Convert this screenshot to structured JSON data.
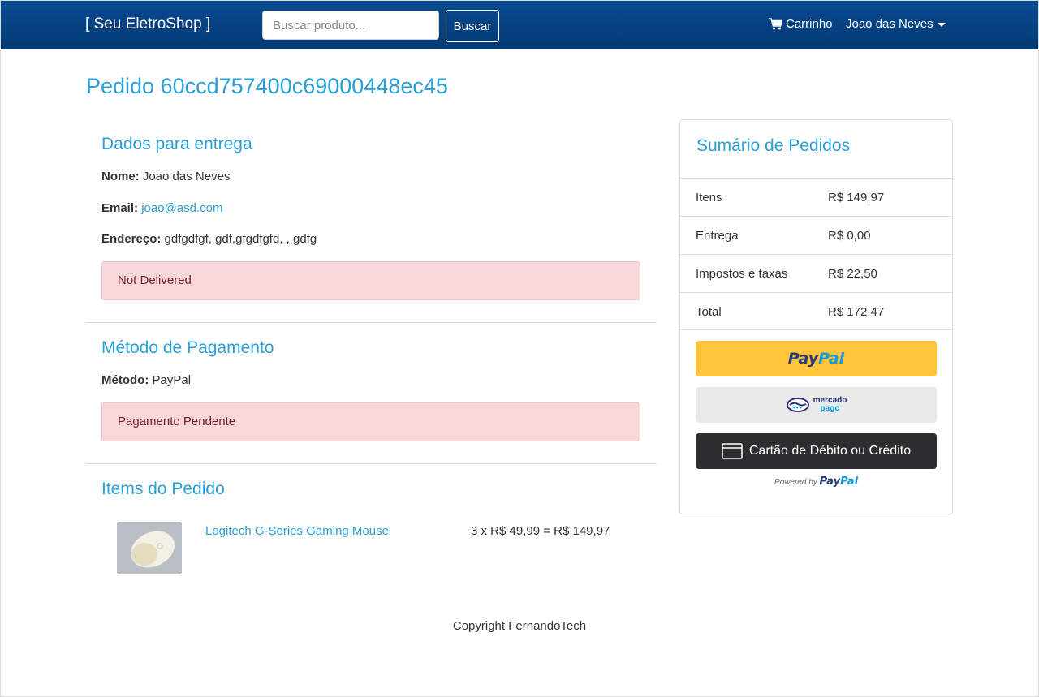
{
  "navbar": {
    "brand": "[ Seu EletroShop ]",
    "search_placeholder": "Buscar produto...",
    "search_button": "Buscar",
    "cart_label": "Carrinho",
    "user_label": "Joao das Neves"
  },
  "order": {
    "title": "Pedido 60ccd757400c69000448ec45"
  },
  "delivery": {
    "heading": "Dados para entrega",
    "name_label": "Nome:",
    "name_value": "Joao das Neves",
    "email_label": "Email:",
    "email_value": "joao@asd.com",
    "address_label": "Endereço:",
    "address_value": "gdfgdfgf, gdf,gfgdfgfd, , gdfg",
    "status": "Not Delivered"
  },
  "payment": {
    "heading": "Método de Pagamento",
    "method_label": "Método:",
    "method_value": "PayPal",
    "status": "Pagamento Pendente"
  },
  "items": {
    "heading": "Items do Pedido",
    "list": [
      {
        "name": "Logitech G-Series Gaming Mouse",
        "calc": "3 x R$ 49,99 = R$ 149,97"
      }
    ]
  },
  "summary": {
    "title": "Sumário de Pedidos",
    "rows": [
      {
        "label": "Itens",
        "value": "R$ 149,97"
      },
      {
        "label": "Entrega",
        "value": "R$ 0,00"
      },
      {
        "label": "Impostos e taxas",
        "value": "R$ 22,50"
      },
      {
        "label": "Total",
        "value": "R$ 172,47"
      }
    ],
    "paypal_part1": "Pay",
    "paypal_part2": "Pal",
    "mp_line1": "mercado",
    "mp_line2": "pago",
    "card_button": "Cartão de Débito ou Crédito",
    "powered_by": "Powered by"
  },
  "footer": {
    "copyright": "Copyright FernandoTech"
  },
  "colors": {
    "accent": "#2a9fd6",
    "navbar": "#033a75",
    "alert_bg": "#f8d7da",
    "paypal_yellow": "#ffc439"
  }
}
